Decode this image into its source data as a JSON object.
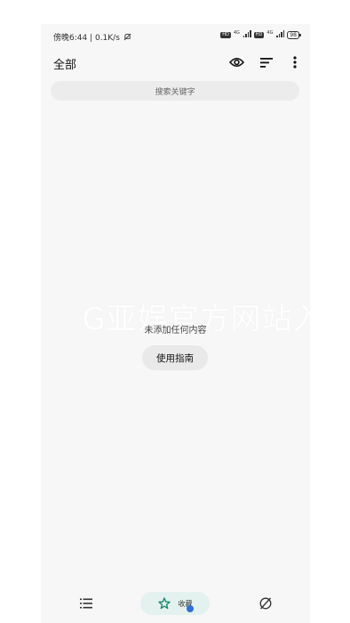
{
  "status_bar": {
    "time_speed": "傍晚6:44 | 0.1K/s",
    "hd1": "HD",
    "gen1": "4G",
    "hd2": "HD",
    "gen2": "4G",
    "battery": "98"
  },
  "header": {
    "title": "全部"
  },
  "search": {
    "placeholder": "搜索关键字"
  },
  "watermark": "G亚娱官方网站入口",
  "empty_state": {
    "message": "未添加任何内容",
    "guide_button": "使用指南"
  },
  "bottom_nav": {
    "favorites_label": "收藏"
  },
  "colors": {
    "background": "#f7f7f7",
    "search_bg": "#ececec",
    "nav_active_bg": "#e3f2ef",
    "nav_active_icon": "#1f8a70",
    "nav_dot": "#2f6fd6"
  }
}
